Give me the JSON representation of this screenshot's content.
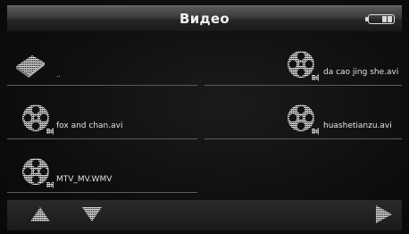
{
  "header": {
    "title": "Видео"
  },
  "status": {
    "battery_icon": "battery-icon"
  },
  "files": [
    {
      "name": "..",
      "icon": "folder-up-icon"
    },
    {
      "name": "da cao jing she.avi",
      "icon": "film-reel-icon"
    },
    {
      "name": "fox and chan.avi",
      "icon": "film-reel-icon"
    },
    {
      "name": "huashetianzu.avi",
      "icon": "film-reel-icon"
    },
    {
      "name": "MTV_MV.WMV",
      "icon": "film-reel-icon"
    }
  ],
  "toolbar": {
    "up_icon": "arrow-up-icon",
    "down_icon": "arrow-down-icon",
    "next_icon": "arrow-right-icon"
  },
  "colors": {
    "background": "#0c0c0c",
    "text": "#e2e2e2",
    "separator": "#5c5c5c"
  }
}
